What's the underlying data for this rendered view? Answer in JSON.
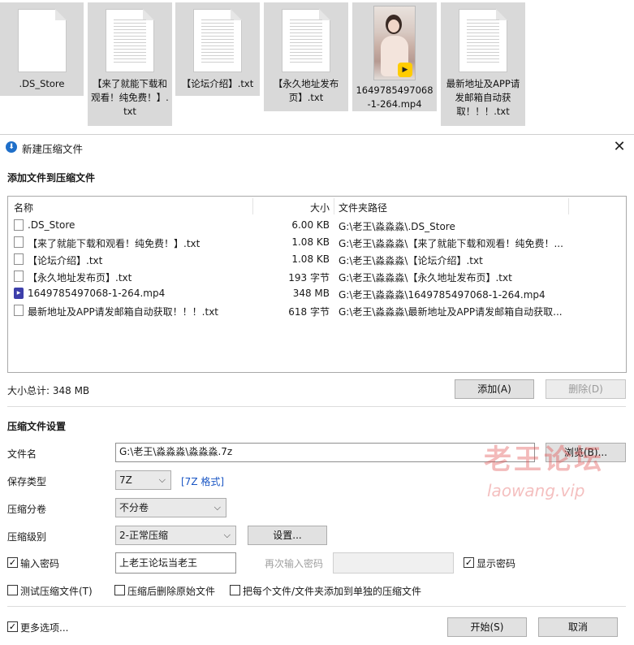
{
  "desktop": {
    "files": [
      {
        "label": ".DS_Store",
        "type": "blank"
      },
      {
        "label": "【来了就能下载和观看！纯免费！】.txt",
        "type": "text"
      },
      {
        "label": "【论坛介绍】.txt",
        "type": "text"
      },
      {
        "label": "【永久地址发布页】.txt",
        "type": "text"
      },
      {
        "label": "1649785497068-1-264.mp4",
        "type": "video",
        "badge": "Player"
      },
      {
        "label": "最新地址及APP请发邮箱自动获取！！！.txt",
        "type": "text"
      }
    ]
  },
  "dialog": {
    "title": "新建压缩文件",
    "add_section_title": "添加文件到压缩文件",
    "columns": {
      "name": "名称",
      "size": "大小",
      "path": "文件夹路径"
    },
    "files": [
      {
        "name": ".DS_Store",
        "size": "6.00 KB",
        "path": "G:\\老王\\淼淼淼\\.DS_Store",
        "icon": "file-icon"
      },
      {
        "name": "【来了就能下载和观看！纯免费！】.txt",
        "size": "1.08 KB",
        "path": "G:\\老王\\淼淼淼\\【来了就能下载和观看！纯免费！...",
        "icon": "text-file-icon"
      },
      {
        "name": "【论坛介绍】.txt",
        "size": "1.08 KB",
        "path": "G:\\老王\\淼淼淼\\【论坛介绍】.txt",
        "icon": "text-file-icon"
      },
      {
        "name": "【永久地址发布页】.txt",
        "size": "193 字节",
        "path": "G:\\老王\\淼淼淼\\【永久地址发布页】.txt",
        "icon": "text-file-icon"
      },
      {
        "name": "1649785497068-1-264.mp4",
        "size": "348 MB",
        "path": "G:\\老王\\淼淼淼\\1649785497068-1-264.mp4",
        "icon": "mp4-icon"
      },
      {
        "name": "最新地址及APP请发邮箱自动获取！！！.txt",
        "size": "618 字节",
        "path": "G:\\老王\\淼淼淼\\最新地址及APP请发邮箱自动获取...",
        "icon": "text-file-icon"
      }
    ],
    "total_size": "大小总计: 348 MB",
    "add_button": "添加(A)",
    "delete_button": "删除(D)",
    "settings_title": "压缩文件设置",
    "filename_label": "文件名",
    "filename_value": "G:\\老王\\淼淼淼\\淼淼淼.7z",
    "browse_button": "浏览(B)...",
    "save_type_label": "保存类型",
    "save_type_value": "7Z",
    "format_link": "[7Z 格式]",
    "split_label": "压缩分卷",
    "split_value": "不分卷",
    "level_label": "压缩级别",
    "level_value": "2-正常压缩",
    "level_settings_button": "设置...",
    "password_label": "输入密码",
    "password_checked": true,
    "password_value": "上老王论坛当老王",
    "reenter_label": "再次输入密码",
    "reenter_value": "",
    "show_password_label": "显示密码",
    "show_password_checked": true,
    "test_label": "测试压缩文件(T)",
    "test_checked": false,
    "delete_after_label": "压缩后删除原始文件",
    "delete_after_checked": false,
    "separate_label": "把每个文件/文件夹添加到单独的压缩文件",
    "separate_checked": false,
    "more_options_label": "更多选项...",
    "more_options_checked": true,
    "start_button": "开始(S)",
    "cancel_button": "取消"
  },
  "watermark": {
    "line1": "老王论坛",
    "line2": "laowang.vip"
  }
}
